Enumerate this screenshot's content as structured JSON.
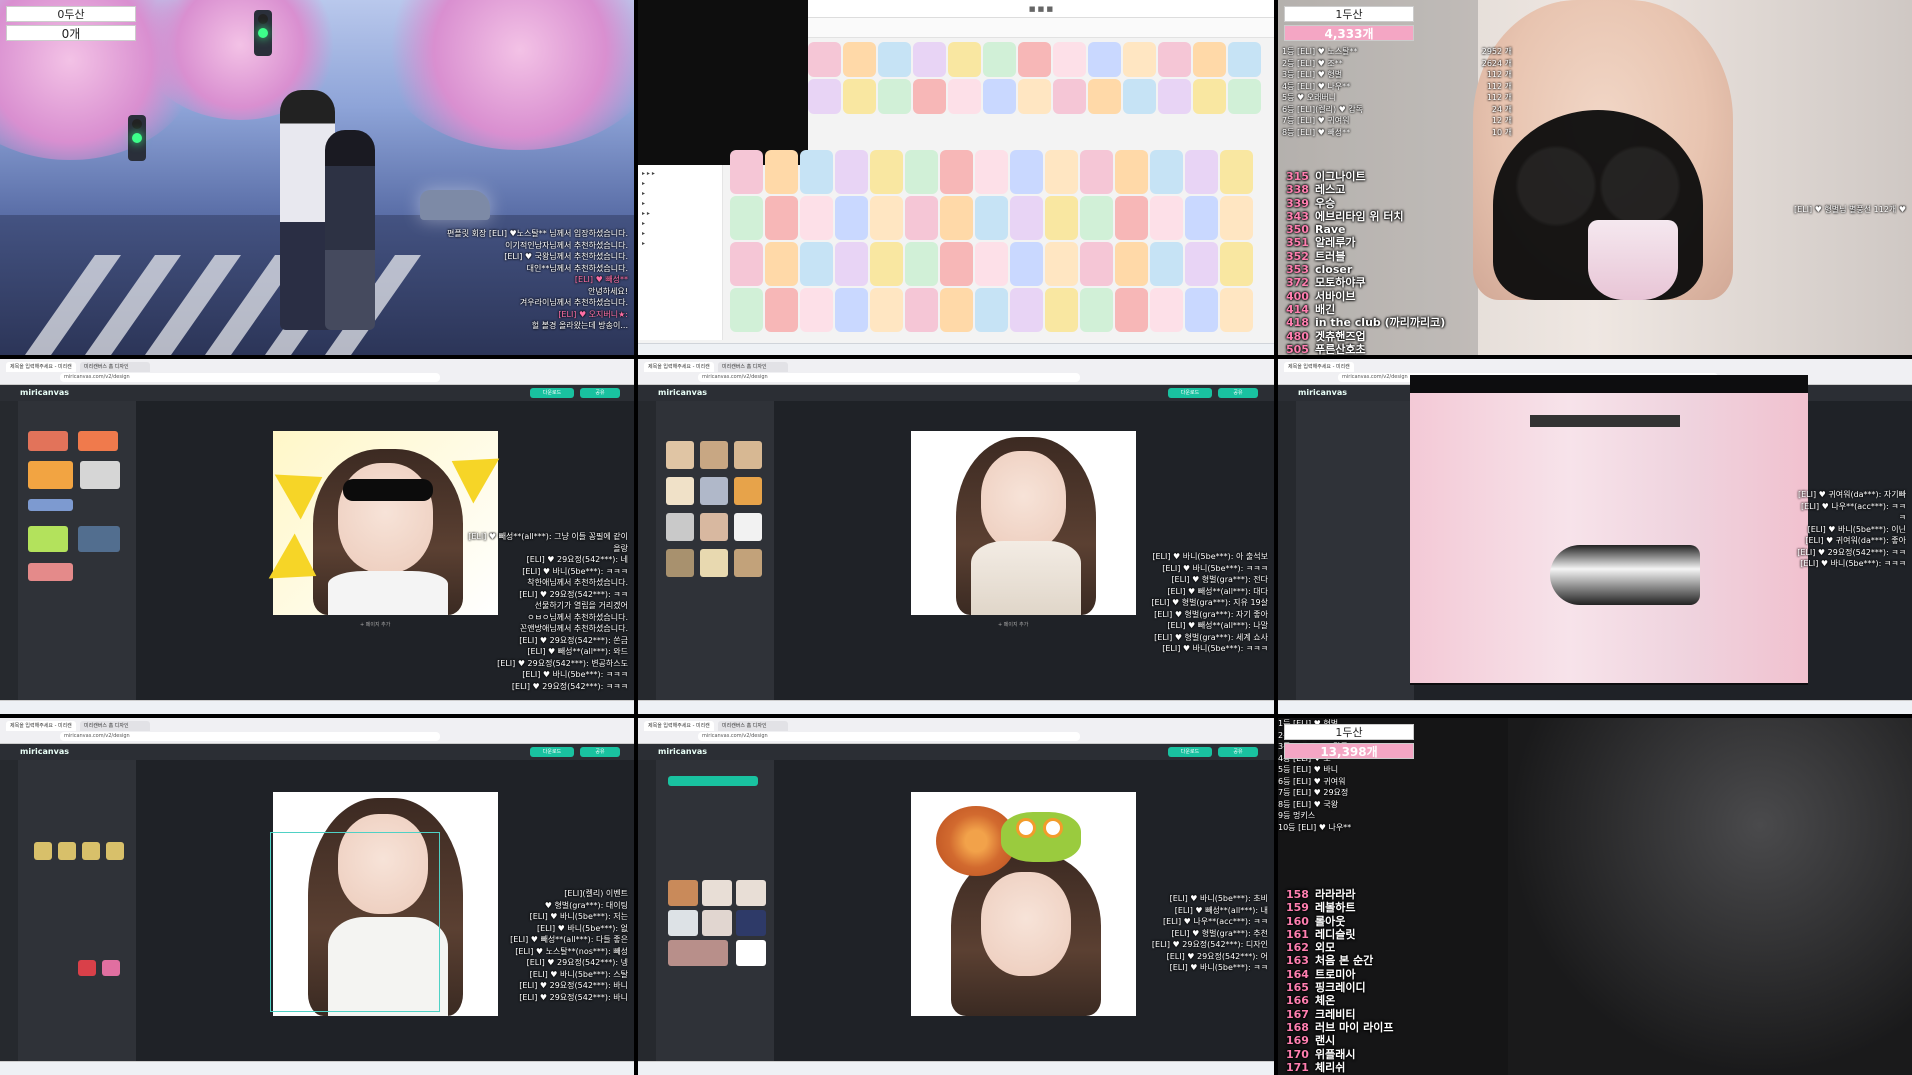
{
  "tiles": {
    "t1": {
      "counter_label": "0두산",
      "counter_value": "0개",
      "chat": [
        "편플릿 회장 [ELI] ♥노스탈** 님께서 입장하셨습니다.",
        "이기적인남자님께서 추천하셨습니다.",
        "[ELI] ♥ 국왕님께서 추천하셨습니다.",
        "대인**님께서 추천하셨습니다.",
        "[ELI] ♥ 빼성**",
        "안녕하세요!",
        "겨우라이님께서 추천하셨습니다.",
        "[ELI] ♥ 오지버니★:",
        "헐 볼경 올라왔는데 방송이..."
      ]
    },
    "t3": {
      "counter_label": "1두산",
      "counter_value": "4,333개",
      "ranks": [
        {
          "rank": "1등 [ELI] ♥ 노스탈**",
          "count": "2952 개"
        },
        {
          "rank": "2등 [ELI] ♥ 조**",
          "count": "2624 개"
        },
        {
          "rank": "3등 [ELI] ♥ 형벌",
          "count": "112 개"
        },
        {
          "rank": "4등 [ELI] ♥ 나우**",
          "count": "112 개"
        },
        {
          "rank": "5등 ♥ 오래버니",
          "count": "112 개"
        },
        {
          "rank": "6등 [ELI](켈리) ♥ 감독",
          "count": "24 개"
        },
        {
          "rank": "7등 [ELI] ♥ 귀여워",
          "count": "12 개"
        },
        {
          "rank": "8등 [ELI] ♥ 빼성**",
          "count": "10 개"
        }
      ],
      "songs": [
        {
          "n": "315",
          "t": "이그나이트"
        },
        {
          "n": "338",
          "t": "레스고"
        },
        {
          "n": "339",
          "t": "우승"
        },
        {
          "n": "343",
          "t": "에브리타임 위 터치"
        },
        {
          "n": "350",
          "t": "Rave"
        },
        {
          "n": "351",
          "t": "알레루가"
        },
        {
          "n": "352",
          "t": "트러블"
        },
        {
          "n": "353",
          "t": "closer"
        },
        {
          "n": "372",
          "t": "모토하야쿠"
        },
        {
          "n": "400",
          "t": "서바이브"
        },
        {
          "n": "414",
          "t": "배긴"
        },
        {
          "n": "418",
          "t": "in the club (까리까리코)"
        },
        {
          "n": "480",
          "t": "겟츄핸즈업"
        },
        {
          "n": "505",
          "t": "푸른산호초"
        }
      ],
      "chat_right": "[ELI] ♥ 형벌님 별풍선 112개 ♥"
    },
    "t9": {
      "counter_label": "1두산",
      "counter_value": "13,398개",
      "ranks": [
        {
          "rank": "1등 [ELI] ♥ 형벌",
          "count": "2953 개"
        },
        {
          "rank": "2등 [ELI] ♥ 노스탈**",
          "count": "2624 개"
        },
        {
          "rank": "3등 [ELI] ♥ ★ 감독",
          "count": "1840 개"
        },
        {
          "rank": "4등 [ELI] ♥ 조**",
          "count": "1424 개"
        },
        {
          "rank": "5등 [ELI] ♥ 바니",
          "count": "1248 개"
        },
        {
          "rank": "6등 [ELI] ♥ 귀여워",
          "count": "1236 개"
        },
        {
          "rank": "7등 [ELI] ♥ 29요정",
          "count": "1212 개"
        },
        {
          "rank": "8등 [ELI] ♥ 국왕",
          "count": "1152 개"
        },
        {
          "rank": "9등 멍키스",
          "count": "282 개"
        },
        {
          "rank": "10등 [ELI] ♥ 나우**",
          "count": "112 개"
        }
      ],
      "songs": [
        {
          "n": "158",
          "t": "라라라라"
        },
        {
          "n": "159",
          "t": "레볼하트"
        },
        {
          "n": "160",
          "t": "롤아웃"
        },
        {
          "n": "161",
          "t": "레디슬릿"
        },
        {
          "n": "162",
          "t": "외모"
        },
        {
          "n": "163",
          "t": "처음 본 순간"
        },
        {
          "n": "164",
          "t": "트로미아"
        },
        {
          "n": "165",
          "t": "핑크레이디"
        },
        {
          "n": "166",
          "t": "체온"
        },
        {
          "n": "167",
          "t": "크레비티"
        },
        {
          "n": "168",
          "t": "러브 마이 라이프"
        },
        {
          "n": "169",
          "t": "랜시"
        },
        {
          "n": "170",
          "t": "위플래시"
        },
        {
          "n": "171",
          "t": "체리쉬"
        }
      ]
    },
    "editor": {
      "logo": "miricanvas",
      "url": "miricanvas.com/v2/design",
      "tab1": "제목을 입력해주세요 - 미리캔",
      "tab2": "미리캔버스 홈 디자인",
      "download_label": "다운로드",
      "share_label": "공유",
      "page_label": "+ 페이지 추가"
    },
    "t4": {
      "chat": [
        "[ELI] ♥ 빼성**(all***): 그냥 이들 꽁필에 같이 올랑",
        "[ELI] ♥ 29요정(542***): 네",
        "[ELI] ♥ 바니(5be***): ㅋㅋㅋ",
        "착한애님께서 추천하셨습니다.",
        "[ELI] ♥ 29요정(542***): ㅋㅋ",
        "선물하기가 열립을 거리겠어",
        "ㅇㅂㅇ님께서 추천하셨습니다.",
        "꼰앤방애님께서 추천하셨습니다.",
        "[ELI] ♥ 29요정(542***): 쏜금",
        "[ELI] ♥ 빼성**(all***): 와드",
        "[ELI] ♥ 29요정(542***): 변공하스도",
        "[ELI] ♥ 바니(5be***): ㅋㅋㅋ",
        "[ELI] ♥ 29요정(542***): ㅋㅋㅋ"
      ]
    },
    "t5": {
      "chat": [
        "[ELI] ♥ 바니(5be***): 아 출석보",
        "[ELI] ♥ 바니(5be***): ㅋㅋㅋ",
        "[ELI] ♥ 형벌(gra***): 전다",
        "[ELI] ♥ 빼성**(all***): 대다",
        "[ELI] ♥ 형벌(gra***): 지유 19살",
        "[ELI] ♥ 형벌(gra***): 자기 좋아",
        "[ELI] ♥ 빼성**(all***): 나말",
        "[ELI] ♥ 형벌(gra***): 세계 쇼사",
        "[ELI] ♥ 바니(5be***): ㅋㅋㅋ"
      ]
    },
    "t6": {
      "chat": [
        "[ELI] ♥ 귀여워(da***): 자기빠",
        "[ELI] ♥ 나우**(acc***): ㅋㅋㅋ",
        "[ELI] ♥ 바니(5be***): 이닌",
        "[ELI] ♥ 귀여워(da***): 좋아",
        "[ELI] ♥ 29요정(542***): ㅋㅋ",
        "[ELI] ♥ 바니(5be***): ㅋㅋㅋ"
      ]
    },
    "t7": {
      "chat": [
        "[ELI](켈리) 이벤트",
        "♥ 형벌(gra***): 대이팅",
        "[ELI] ♥ 바니(5be***): 저는",
        "[ELI] ♥ 바니(5be***): 없",
        "[ELI] ♥ 빼성**(all***): 다들 좋은",
        "[ELI] ♥ 노스탈**(nos***): 빼성",
        "[ELI] ♥ 29요정(542***): 넹",
        "[ELI] ♥ 바니(5be***): 스탈",
        "[ELI] ♥ 29요정(542***): 바니",
        "[ELI] ♥ 29요정(542***): 바니"
      ]
    },
    "t8": {
      "chat": [
        "[ELI] ♥ 바니(5be***): 초비",
        "[ELI] ♥ 빼성**(all***): 내",
        "[ELI] ♥ 나우**(acc***): ㅋㅋ",
        "[ELI] ♥ 형벌(gra***): 추천",
        "[ELI] ♥ 29요정(542***): 디자인",
        "[ELI] ♥ 29요정(542***): 어",
        "[ELI] ♥ 바니(5be***): ㅋㅋ"
      ]
    }
  },
  "colors": {
    "accent": "#19c2a0",
    "pink": "#f4a6c4"
  }
}
